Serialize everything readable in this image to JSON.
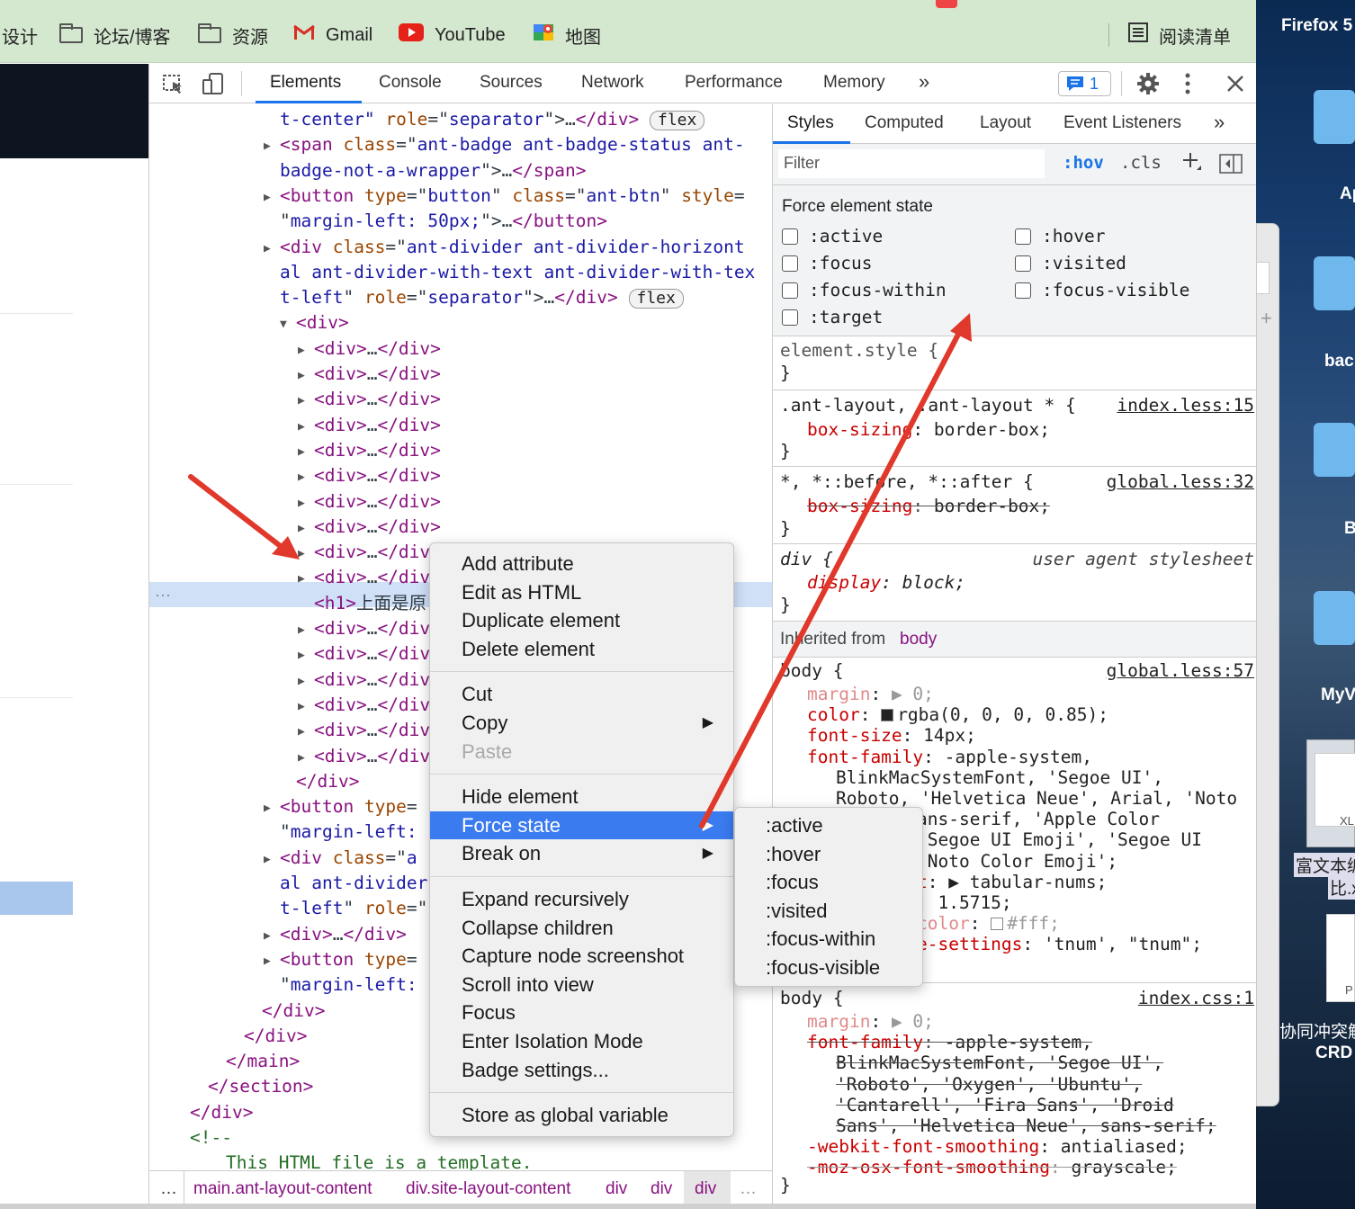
{
  "bookmarks": {
    "items": [
      {
        "label": "设计",
        "icon": "none"
      },
      {
        "label": "论坛/博客",
        "icon": "folder-icon"
      },
      {
        "label": "资源",
        "icon": "folder-icon"
      },
      {
        "label": "Gmail",
        "icon": "gmail-icon"
      },
      {
        "label": "YouTube",
        "icon": "youtube-icon"
      },
      {
        "label": "地图",
        "icon": "maps-icon"
      }
    ],
    "reading_list": "阅读清单"
  },
  "devtools": {
    "tabs": [
      "Elements",
      "Console",
      "Sources",
      "Network",
      "Performance",
      "Memory"
    ],
    "active_tab": "Elements",
    "issues_count": "1",
    "more_tabs": "»"
  },
  "elements": {
    "lines": [
      {
        "indent": 0,
        "parts": [
          [
            "av",
            "t-center\""
          ],
          [
            "tx",
            " "
          ],
          [
            "at",
            "role"
          ],
          [
            "tx",
            "=\""
          ],
          [
            "av",
            "separator"
          ],
          [
            "tx",
            "\">"
          ],
          [
            "tx",
            "…"
          ],
          [
            "tg",
            "</div>"
          ]
        ],
        "pill": "flex"
      },
      {
        "indent": 0,
        "tri": "▶",
        "parts": [
          [
            "tg",
            "<span"
          ],
          [
            "tx",
            " "
          ],
          [
            "at",
            "class"
          ],
          [
            "tx",
            "=\""
          ],
          [
            "av",
            "ant-badge ant-badge-status ant-"
          ]
        ]
      },
      {
        "indent": 0,
        "parts": [
          [
            "av",
            "badge-not-a-wrapper"
          ],
          [
            "tx",
            "\">"
          ],
          [
            "tx",
            "…"
          ],
          [
            "tg",
            "</span>"
          ]
        ]
      },
      {
        "indent": 0,
        "tri": "▶",
        "parts": [
          [
            "tg",
            "<button"
          ],
          [
            "tx",
            " "
          ],
          [
            "at",
            "type"
          ],
          [
            "tx",
            "=\""
          ],
          [
            "av",
            "button"
          ],
          [
            "tx",
            "\" "
          ],
          [
            "at",
            "class"
          ],
          [
            "tx",
            "=\""
          ],
          [
            "av",
            "ant-btn"
          ],
          [
            "tx",
            "\" "
          ],
          [
            "at",
            "style"
          ],
          [
            "tx",
            "="
          ]
        ]
      },
      {
        "indent": 0,
        "parts": [
          [
            "tx",
            "\""
          ],
          [
            "av",
            "margin-left: 50px;"
          ],
          [
            "tx",
            "\">"
          ],
          [
            "tx",
            "…"
          ],
          [
            "tg",
            "</button>"
          ]
        ]
      },
      {
        "indent": 0,
        "tri": "▶",
        "parts": [
          [
            "tg",
            "<div"
          ],
          [
            "tx",
            " "
          ],
          [
            "at",
            "class"
          ],
          [
            "tx",
            "=\""
          ],
          [
            "av",
            "ant-divider ant-divider-horizont"
          ]
        ]
      },
      {
        "indent": 0,
        "parts": [
          [
            "av",
            "al ant-divider-with-text ant-divider-with-tex"
          ]
        ]
      },
      {
        "indent": 0,
        "parts": [
          [
            "av",
            "t-left"
          ],
          [
            "tx",
            "\" "
          ],
          [
            "at",
            "role"
          ],
          [
            "tx",
            "=\""
          ],
          [
            "av",
            "separator"
          ],
          [
            "tx",
            "\">"
          ],
          [
            "tx",
            "…"
          ],
          [
            "tg",
            "</div>"
          ]
        ],
        "pill": "flex"
      },
      {
        "indent": 1,
        "tri": "▼",
        "parts": [
          [
            "tg",
            "<div>"
          ]
        ]
      },
      {
        "indent": 2,
        "tri": "▶",
        "parts": [
          [
            "tg",
            "<div>"
          ],
          [
            "tx",
            "…"
          ],
          [
            "tg",
            "</div>"
          ]
        ]
      },
      {
        "indent": 2,
        "tri": "▶",
        "parts": [
          [
            "tg",
            "<div>"
          ],
          [
            "tx",
            "…"
          ],
          [
            "tg",
            "</div>"
          ]
        ]
      },
      {
        "indent": 2,
        "tri": "▶",
        "parts": [
          [
            "tg",
            "<div>"
          ],
          [
            "tx",
            "…"
          ],
          [
            "tg",
            "</div>"
          ]
        ]
      },
      {
        "indent": 2,
        "tri": "▶",
        "parts": [
          [
            "tg",
            "<div>"
          ],
          [
            "tx",
            "…"
          ],
          [
            "tg",
            "</div>"
          ]
        ]
      },
      {
        "indent": 2,
        "tri": "▶",
        "parts": [
          [
            "tg",
            "<div>"
          ],
          [
            "tx",
            "…"
          ],
          [
            "tg",
            "</div>"
          ]
        ]
      },
      {
        "indent": 2,
        "tri": "▶",
        "parts": [
          [
            "tg",
            "<div>"
          ],
          [
            "tx",
            "…"
          ],
          [
            "tg",
            "</div>"
          ]
        ]
      },
      {
        "indent": 2,
        "tri": "▶",
        "parts": [
          [
            "tg",
            "<div>"
          ],
          [
            "tx",
            "…"
          ],
          [
            "tg",
            "</div>"
          ]
        ]
      },
      {
        "indent": 2,
        "tri": "▶",
        "parts": [
          [
            "tg",
            "<div>"
          ],
          [
            "tx",
            "…"
          ],
          [
            "tg",
            "</div>"
          ]
        ]
      },
      {
        "indent": 2,
        "tri": "▶",
        "parts": [
          [
            "tg",
            "<div>"
          ],
          [
            "tx",
            "…"
          ],
          [
            "tg",
            "</div>"
          ]
        ],
        "selected": true
      },
      {
        "indent": 2,
        "tri": "▶",
        "parts": [
          [
            "tg",
            "<div>"
          ],
          [
            "tx",
            "…"
          ],
          [
            "tg",
            "</div>"
          ]
        ]
      },
      {
        "indent": 2,
        "parts": [
          [
            "tg",
            "<h1>"
          ],
          [
            "tx",
            "上面是原"
          ]
        ]
      },
      {
        "indent": 2,
        "tri": "▶",
        "parts": [
          [
            "tg",
            "<div>"
          ],
          [
            "tx",
            "…"
          ],
          [
            "tg",
            "</div>"
          ]
        ]
      },
      {
        "indent": 2,
        "tri": "▶",
        "parts": [
          [
            "tg",
            "<div>"
          ],
          [
            "tx",
            "…"
          ],
          [
            "tg",
            "</div>"
          ]
        ]
      },
      {
        "indent": 2,
        "tri": "▶",
        "parts": [
          [
            "tg",
            "<div>"
          ],
          [
            "tx",
            "…"
          ],
          [
            "tg",
            "</div>"
          ]
        ]
      },
      {
        "indent": 2,
        "tri": "▶",
        "parts": [
          [
            "tg",
            "<div>"
          ],
          [
            "tx",
            "…"
          ],
          [
            "tg",
            "</div>"
          ]
        ]
      },
      {
        "indent": 2,
        "tri": "▶",
        "parts": [
          [
            "tg",
            "<div>"
          ],
          [
            "tx",
            "…"
          ],
          [
            "tg",
            "</div>"
          ]
        ]
      },
      {
        "indent": 2,
        "tri": "▶",
        "parts": [
          [
            "tg",
            "<div>"
          ],
          [
            "tx",
            "…"
          ],
          [
            "tg",
            "</div>"
          ]
        ]
      },
      {
        "indent": 1,
        "parts": [
          [
            "tg",
            "</div>"
          ]
        ]
      },
      {
        "indent": 0,
        "tri": "▶",
        "parts": [
          [
            "tg",
            "<button"
          ],
          [
            "tx",
            " "
          ],
          [
            "at",
            "type"
          ],
          [
            "tx",
            "="
          ]
        ]
      },
      {
        "indent": 0,
        "parts": [
          [
            "tx",
            "\""
          ],
          [
            "av",
            "margin-left: "
          ]
        ]
      },
      {
        "indent": 0,
        "tri": "▶",
        "parts": [
          [
            "tg",
            "<div"
          ],
          [
            "tx",
            " "
          ],
          [
            "at",
            "class"
          ],
          [
            "tx",
            "=\""
          ],
          [
            "av",
            "a"
          ]
        ]
      },
      {
        "indent": 0,
        "parts": [
          [
            "av",
            "al ant-divider"
          ]
        ]
      },
      {
        "indent": 0,
        "parts": [
          [
            "av",
            "t-left"
          ],
          [
            "tx",
            "\" "
          ],
          [
            "at",
            "role"
          ],
          [
            "tx",
            "=\""
          ]
        ]
      },
      {
        "indent": 0,
        "tri": "▶",
        "parts": [
          [
            "tg",
            "<div>"
          ],
          [
            "tx",
            "…"
          ],
          [
            "tg",
            "</div>"
          ]
        ]
      },
      {
        "indent": 0,
        "tri": "▶",
        "parts": [
          [
            "tg",
            "<button"
          ],
          [
            "tx",
            " "
          ],
          [
            "at",
            "type"
          ],
          [
            "tx",
            "="
          ]
        ]
      },
      {
        "indent": 0,
        "parts": [
          [
            "tx",
            "\""
          ],
          [
            "av",
            "margin-left: "
          ]
        ]
      },
      {
        "indent": -1,
        "parts": [
          [
            "tg",
            "</div>"
          ]
        ]
      },
      {
        "indent": -2,
        "parts": [
          [
            "tg",
            "</div>"
          ]
        ]
      },
      {
        "indent": -3,
        "parts": [
          [
            "tg",
            "</main>"
          ]
        ]
      },
      {
        "indent": -4,
        "parts": [
          [
            "tg",
            "</section>"
          ]
        ]
      },
      {
        "indent": -5,
        "parts": [
          [
            "tg",
            "</div>"
          ]
        ]
      },
      {
        "indent": -5,
        "parts": [
          [
            "cm",
            "<!--"
          ]
        ]
      },
      {
        "indent": -3,
        "parts": [
          [
            "cm",
            "This HTML file is a template."
          ]
        ]
      }
    ]
  },
  "breadcrumbs": [
    "main.ant-layout-content",
    "div.site-layout-content",
    "div",
    "div",
    "div"
  ],
  "breadcrumb_more": "…",
  "styles": {
    "tabs": [
      "Styles",
      "Computed",
      "Layout",
      "Event Listeners"
    ],
    "active_tab": "Styles",
    "filter_placeholder": "Filter",
    "hov": ":hov",
    "cls": ".cls",
    "force_state_title": "Force element state",
    "states_left": [
      ":active",
      ":focus",
      ":focus-within",
      ":target"
    ],
    "states_right": [
      ":hover",
      ":visited",
      ":focus-visible"
    ],
    "inherited_label": "Inherited from",
    "inherited_tag": "body"
  },
  "rules": {
    "element_style": [
      "element.style {",
      "}"
    ],
    "r1": {
      "sel": ".ant-layout, .ant-layout * {",
      "src": "index.less:15",
      "props": [
        [
          "box-sizing",
          "border-box;"
        ]
      ]
    },
    "r2": {
      "sel": "*, *::before, *::after {",
      "src": "global.less:32",
      "props": [
        [
          "box-sizing",
          "border-box;"
        ]
      ]
    },
    "r3": {
      "sel": "div {",
      "src": "user agent stylesheet",
      "props": [
        [
          "display",
          "block;"
        ]
      ]
    },
    "r4": {
      "sel": "body {",
      "src": "global.less:57",
      "lines": [
        [
          "margin",
          "▶ 0;"
        ],
        [
          "color",
          "rgba(0, 0, 0, 0.85);"
        ],
        [
          "font-size",
          "14px;"
        ],
        [
          "font-family",
          "-apple-system,"
        ],
        [
          "",
          "BlinkMacSystemFont, 'Segoe UI',"
        ],
        [
          "",
          "Roboto, 'Helvetica Neue', Arial, 'Noto"
        ],
        [
          "",
          "ans-serif, 'Apple Color"
        ],
        [
          "",
          "'Segoe UI Emoji', 'Segoe UI"
        ],
        [
          "",
          "'Noto Color Emoji';"
        ],
        [
          "t",
          "▶ tabular-nums;"
        ],
        [
          "",
          ": 1.5715;"
        ],
        [
          "color",
          "#fff;"
        ],
        [
          "e-settings",
          "'tnum', \"tnum\";"
        ]
      ]
    },
    "r5": {
      "sel": "body {",
      "src": "index.css:1",
      "lines": [
        [
          "margin",
          "▶ 0;"
        ],
        [
          "font-family",
          "-apple-system,"
        ],
        [
          "",
          "BlinkMacSystemFont, 'Segoe UI',"
        ],
        [
          "",
          "'Roboto', 'Oxygen', 'Ubuntu',"
        ],
        [
          "",
          "'Cantarell', 'Fira Sans', 'Droid"
        ],
        [
          "",
          "Sans', 'Helvetica Neue', sans-serif;"
        ],
        [
          "-webkit-font-smoothing",
          "antialiased;"
        ],
        [
          "-moz-osx-font-smoothing",
          "grayscale;"
        ]
      ]
    }
  },
  "context_menu": {
    "groups": [
      [
        "Add attribute",
        "Edit as HTML",
        "Duplicate element",
        "Delete element"
      ],
      [
        "Cut",
        "Copy",
        "Paste"
      ],
      [
        "Hide element",
        "Force state",
        "Break on"
      ],
      [
        "Expand recursively",
        "Collapse children",
        "Capture node screenshot",
        "Scroll into view",
        "Focus",
        "Enter Isolation Mode",
        "Badge settings..."
      ],
      [
        "Store as global variable"
      ]
    ],
    "disabled": [
      "Paste"
    ],
    "highlighted": "Force state",
    "has_submenu": [
      "Copy",
      "Force state",
      "Break on"
    ]
  },
  "submenu": [
    ":active",
    ":hover",
    ":focus",
    ":visited",
    ":focus-within",
    ":focus-visible"
  ],
  "desktop": {
    "labels": [
      "Firefox 5",
      "Ap",
      "bac",
      "B",
      "MyV",
      "XL",
      "富文本编",
      "比.x",
      "P",
      "协同冲突解",
      "CRD"
    ]
  },
  "colors": {
    "bookmarks_bg": "#d4e7cf",
    "accent": "#1a73e8",
    "highlight": "#3a7bf0",
    "annotation_arrow": "#e0392b"
  }
}
